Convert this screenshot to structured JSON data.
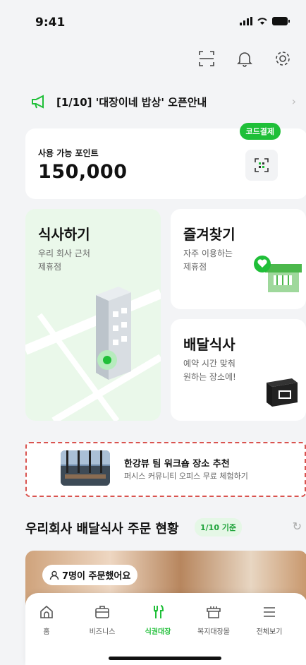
{
  "status_bar": {
    "time": "9:41"
  },
  "notice": {
    "text": "[1/10] '대장이네 밥상' 오픈안내"
  },
  "points": {
    "label": "사용 가능 포인트",
    "value": "150,000",
    "code_pay_label": "코드결제"
  },
  "cards": {
    "meal": {
      "title": "식사하기",
      "desc": "우리 회사 근처\n제휴점"
    },
    "favorites": {
      "title": "즐겨찾기",
      "desc": "자주 이용하는\n제휴점"
    },
    "delivery": {
      "title": "배달식사",
      "desc": "예약 시간 맞춰\n원하는 장소에!"
    }
  },
  "banner": {
    "title": "한강뷰 팀 워크숍 장소 추천",
    "subtitle": "퍼시스 커뮤니티 오피스 무료 체험하기"
  },
  "section": {
    "title": "우리회사 배달식사 주문 현황",
    "badge": "1/10 기준"
  },
  "orders_chip": "7명이 주문했어요",
  "tabs": [
    {
      "label": "홈",
      "icon": "home-icon"
    },
    {
      "label": "비즈니스",
      "icon": "briefcase-icon"
    },
    {
      "label": "식권대장",
      "icon": "fork-knife-icon"
    },
    {
      "label": "복지대장몰",
      "icon": "store-icon"
    },
    {
      "label": "전체보기",
      "icon": "menu-icon"
    }
  ],
  "colors": {
    "accent": "#1fbf38",
    "banner_border": "#d9534f"
  }
}
